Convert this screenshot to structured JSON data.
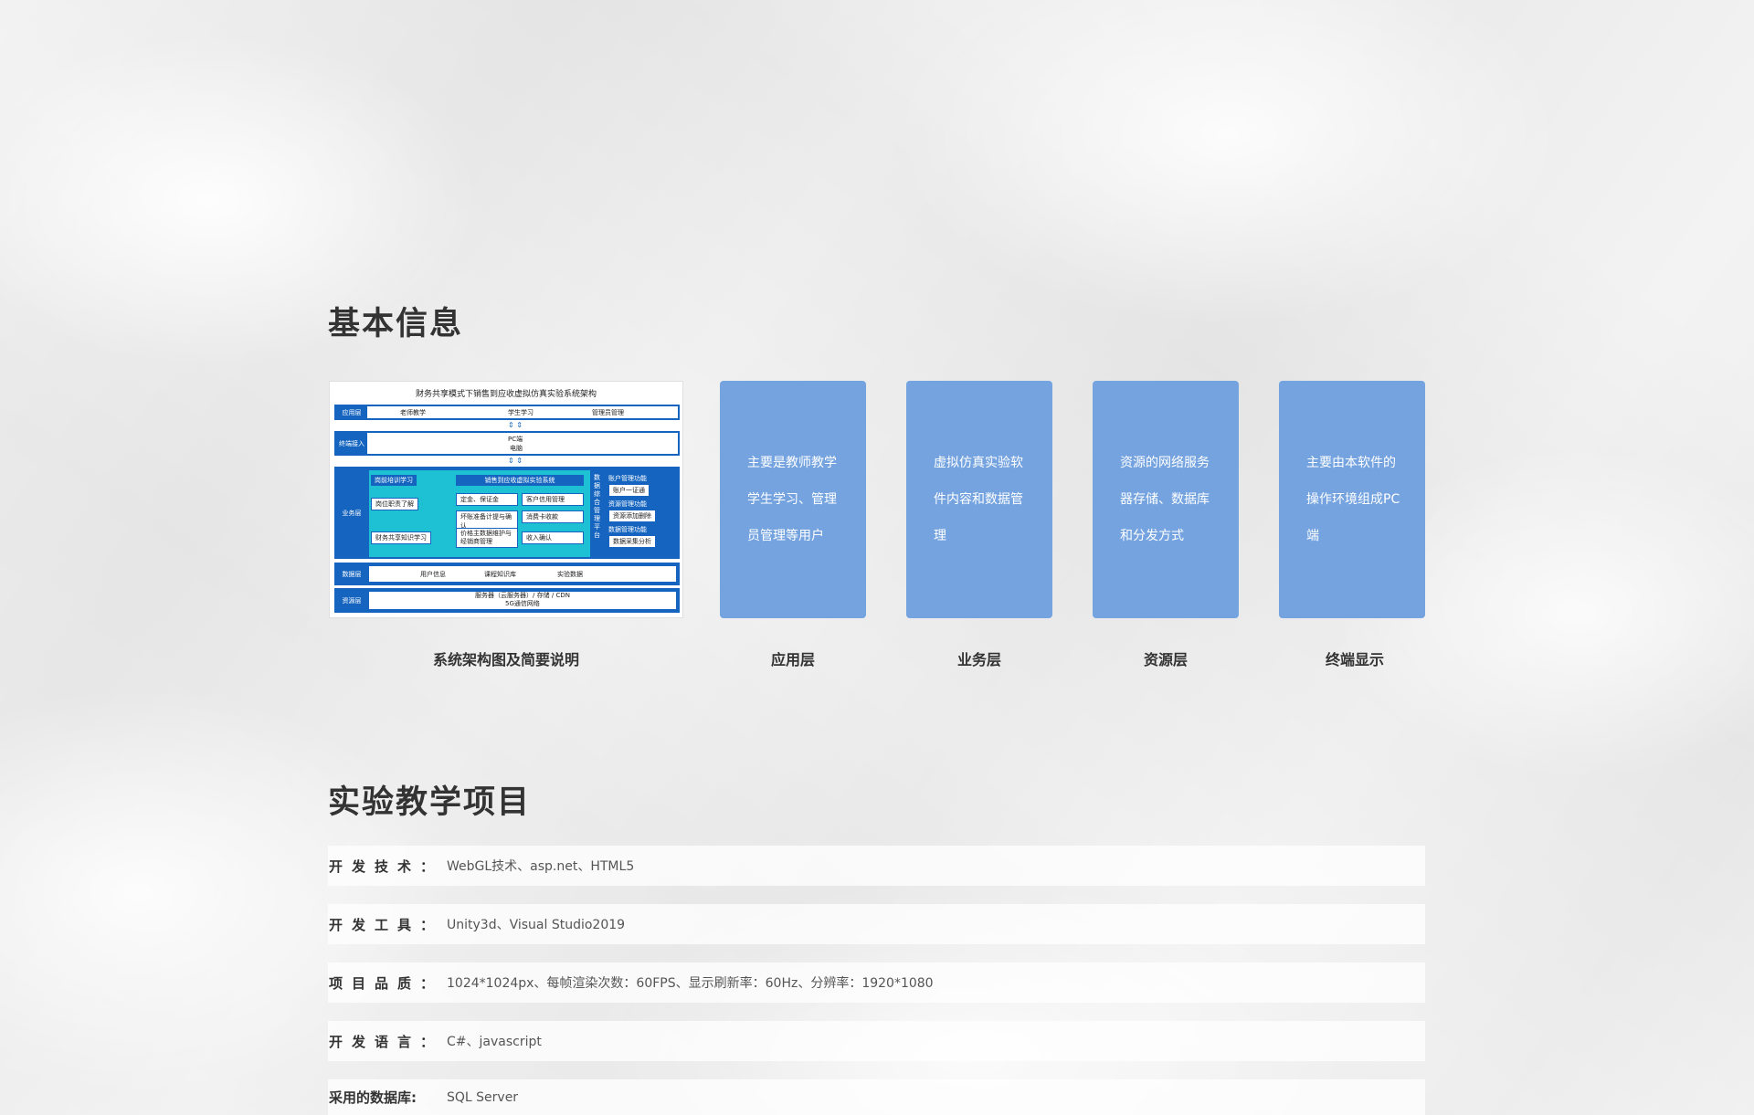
{
  "basic_info": {
    "title": "基本信息",
    "diagram": {
      "title": "财务共享模式下销售到应收虚拟仿真实验系统架构",
      "app_layer": {
        "tag": "应用层",
        "items": [
          "老师教学",
          "学生学习",
          "管理员管理"
        ]
      },
      "terminal_layer": {
        "tag": "终端接入",
        "items": [
          "PC端",
          "电脑"
        ]
      },
      "business_layer": {
        "tag": "业务层",
        "left_items": [
          "岗前培训学习",
          "岗位职责了解",
          "财务共享知识学习"
        ],
        "system_title": "销售到应收虚拟实验系统",
        "system_items": [
          "定金、保证金",
          "客户信用管理",
          "坏账准备计提与确认",
          "消费卡收款",
          "价格主数据维护与经销商管理",
          "收入确认"
        ],
        "platform_label": "数据综合管理平台",
        "platform_items": [
          "账户管理功能",
          "账户一证通",
          "资源管理功能",
          "资源添加删除",
          "数据管理功能",
          "数据采集分析"
        ]
      },
      "data_layer": {
        "tag": "数据层",
        "items": [
          "用户信息",
          "课程知识库",
          "实验数据"
        ]
      },
      "resource_layer": {
        "tag": "资源层",
        "items": [
          "服务器（云服务器）/ 存储 / CDN",
          "5G通信网络"
        ]
      }
    },
    "diagram_caption": "系统架构图及简要说明",
    "cards": [
      {
        "text": "主要是教师教学学生学习、管理员管理等用户",
        "caption": "应用层"
      },
      {
        "text": "虚拟仿真实验软件内容和数据管理",
        "caption": "业务层"
      },
      {
        "text": "资源的网络服务器存储、数据库和分发方式",
        "caption": "资源层"
      },
      {
        "text": "主要由本软件的操作环境组成PC端",
        "caption": "终端显示"
      }
    ],
    "card_color": "#74a3e0",
    "diagram_blue": "#1565c0",
    "diagram_cyan": "#1ec1d3"
  },
  "projects": {
    "title": "实验教学项目",
    "rows": [
      {
        "label": "开发技术：",
        "value": "WebGL技术、asp.net、HTML5"
      },
      {
        "label": "开发工具：",
        "value": "Unity3d、Visual Studio2019"
      },
      {
        "label": "项目品质：",
        "value": "1024*1024px、每帧渲染次数：60FPS、显示刷新率：60Hz、分辨率：1920*1080"
      },
      {
        "label": "开发语言：",
        "value": "C#、javascript"
      },
      {
        "label": "采用的数据库:",
        "value": "SQL Server"
      }
    ]
  }
}
